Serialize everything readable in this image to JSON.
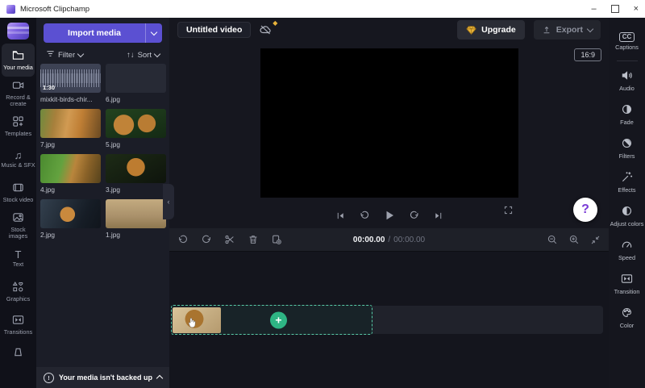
{
  "titlebar": {
    "title": "Microsoft Clipchamp",
    "minimize": "–",
    "close": "×"
  },
  "header": {
    "project_title": "Untitled video",
    "upgrade_label": "Upgrade",
    "export_label": "Export"
  },
  "left_nav": {
    "items": [
      {
        "label": "Your media"
      },
      {
        "label": "Record & create"
      },
      {
        "label": "Templates"
      },
      {
        "label": "Music & SFX"
      },
      {
        "label": "Stock video"
      },
      {
        "label": "Stock images"
      },
      {
        "label": "Text"
      },
      {
        "label": "Graphics"
      },
      {
        "label": "Transitions"
      }
    ]
  },
  "media_panel": {
    "import_label": "Import media",
    "filter_label": "Filter",
    "sort_label": "Sort",
    "items": [
      {
        "name": "mixkit-birds-chir...",
        "duration": "1:30"
      },
      {
        "name": "6.jpg"
      },
      {
        "name": "7.jpg"
      },
      {
        "name": "5.jpg"
      },
      {
        "name": "4.jpg"
      },
      {
        "name": "3.jpg"
      },
      {
        "name": "2.jpg"
      },
      {
        "name": "1.jpg"
      }
    ],
    "backup_notice": "Your media isn't backed up"
  },
  "preview": {
    "aspect_ratio": "16:9",
    "help_label": "?"
  },
  "timeline": {
    "time_current": "00:00.00",
    "time_separator": "/",
    "time_total": "00:00.00",
    "add_label": "+"
  },
  "right_nav": {
    "items": [
      {
        "label": "Captions"
      },
      {
        "label": "Audio"
      },
      {
        "label": "Fade"
      },
      {
        "label": "Filters"
      },
      {
        "label": "Effects"
      },
      {
        "label": "Adjust colors"
      },
      {
        "label": "Speed"
      },
      {
        "label": "Transition"
      },
      {
        "label": "Color"
      }
    ]
  },
  "icons_text": {
    "sort_arrows": "↑↓",
    "music_note": "♫",
    "text_glyph": "T",
    "captions_cc": "CC",
    "info_mark": "!",
    "collapse_left": "‹",
    "gem_dot": "◆"
  },
  "colors": {
    "accent_purple": "#5b50d2",
    "accent_green": "#2eb584",
    "dash_teal": "#58c9a7",
    "gem_gold": "#e8b33a",
    "help_purple": "#7a3bd6"
  }
}
